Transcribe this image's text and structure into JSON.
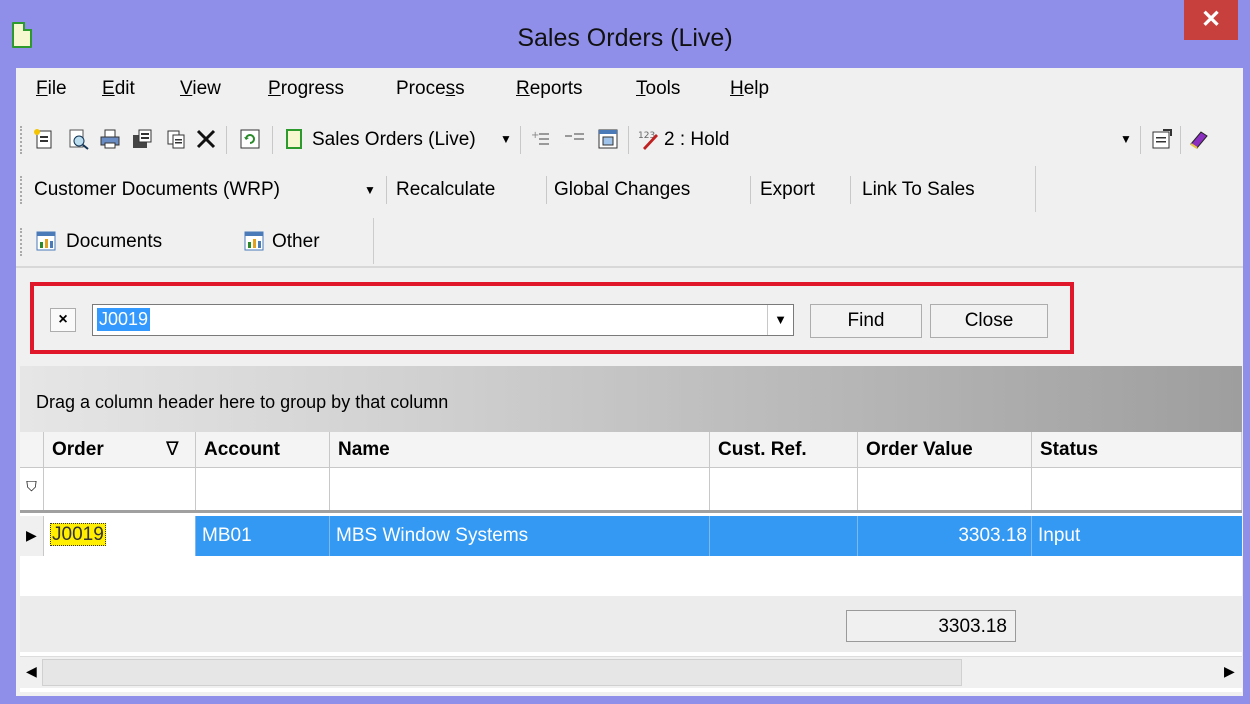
{
  "window": {
    "title": "Sales Orders (Live)",
    "close_glyph": "✕"
  },
  "menu": [
    {
      "pre": "",
      "ul": "F",
      "post": "ile"
    },
    {
      "pre": "",
      "ul": "E",
      "post": "dit"
    },
    {
      "pre": "",
      "ul": "V",
      "post": "iew"
    },
    {
      "pre": "",
      "ul": "P",
      "post": "rogress"
    },
    {
      "pre": "Proce",
      "ul": "s",
      "post": "s"
    },
    {
      "pre": "",
      "ul": "R",
      "post": "eports"
    },
    {
      "pre": "",
      "ul": "T",
      "post": "ools"
    },
    {
      "pre": "",
      "ul": "H",
      "post": "elp"
    }
  ],
  "toolbar1": {
    "view_select": "Sales Orders (Live)",
    "status_select": "2 : Hold",
    "icons": [
      "new-icon",
      "preview-icon",
      "print-icon",
      "copy-to-icon",
      "copy-icon",
      "delete-icon",
      "refresh-icon",
      "view-icon",
      "insert-line-icon",
      "remove-line-icon",
      "columns-icon",
      "hold-icon",
      "properties-icon",
      "help-book-icon"
    ]
  },
  "toolbar2": {
    "customer_documents": "Customer Documents (WRP)",
    "recalculate": "Recalculate",
    "global_changes": "Global Changes",
    "export": "Export",
    "link_to_sales": "Link To Sales"
  },
  "toolbar3": {
    "documents": "Documents",
    "other": "Other"
  },
  "find": {
    "value": "J0019",
    "clear_glyph": "×",
    "find_label": "Find",
    "close_label": "Close",
    "highlight_color": "#e0162b"
  },
  "grid": {
    "group_hint": "Drag a column header here to group by that column",
    "columns": [
      "Order",
      "Account",
      "Name",
      "Cust. Ref.",
      "Order Value",
      "Status"
    ],
    "sort_indicator": "∇",
    "rows": [
      {
        "order": "J0019",
        "account": "MB01",
        "name": "MBS Window Systems",
        "cust_ref": "",
        "order_value": "3303.18",
        "status": "Input"
      }
    ],
    "total_order_value": "3303.18",
    "selection_color": "#3399f3"
  }
}
